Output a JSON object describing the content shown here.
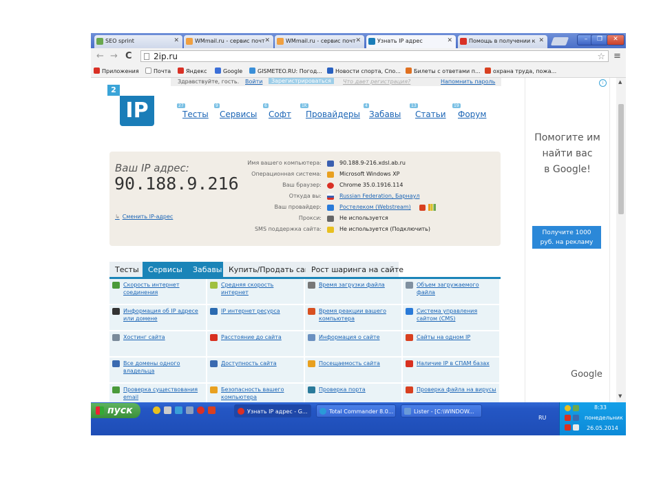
{
  "browser": {
    "tabs": [
      {
        "title": "SEO sprint",
        "color": "#6aa84f"
      },
      {
        "title": "WMmail.ru - сервис почт",
        "color": "#f0a040"
      },
      {
        "title": "WMmail.ru - сервис почт",
        "color": "#f0a040"
      },
      {
        "title": "Узнать IP адрес",
        "color": "#1a7db8"
      },
      {
        "title": "Помощь в получении к",
        "color": "#d93025"
      }
    ],
    "url": "2ip.ru",
    "bookmarks": [
      {
        "label": "Приложения",
        "color": "#d93025"
      },
      {
        "label": "Почта",
        "color": "#999999"
      },
      {
        "label": "Яндекс",
        "color": "#d93025"
      },
      {
        "label": "Google",
        "color": "#3b6fd8"
      },
      {
        "label": "GISMETEO.RU: Погод...",
        "color": "#3a8fd8"
      },
      {
        "label": "Новости спорта, Спо...",
        "color": "#2860c0"
      },
      {
        "label": "Билеты с ответами п...",
        "color": "#e07020"
      },
      {
        "label": "охрана труда, пожа...",
        "color": "#d84020"
      }
    ]
  },
  "site": {
    "topbar": {
      "greeting": "Здравствуйте, гость.",
      "login": "Войти",
      "register": "Зарегистрироваться",
      "why": "Что дает регистрация?",
      "forgot": "Напомнить пароль"
    },
    "logo_num": "2",
    "logo_text": "IP",
    "nav": [
      {
        "label": "Тесты",
        "badge": "27"
      },
      {
        "label": "Сервисы",
        "badge": "9"
      },
      {
        "label": "Софт",
        "badge": "6"
      },
      {
        "label": "Провайдеры",
        "badge": "1K"
      },
      {
        "label": "Забавы",
        "badge": "4"
      },
      {
        "label": "Статьи",
        "badge": "13"
      },
      {
        "label": "Форум",
        "badge": "19"
      }
    ],
    "ip": {
      "label": "Ваш IP адрес:",
      "address": "90.188.9.216",
      "change_link": "Сменить IP-адрес"
    },
    "info": [
      {
        "key": "Имя вашего компьютера:",
        "value": "90.188.9-216.xdsl.ab.ru",
        "link": false,
        "icon_color": "#3a5fb0"
      },
      {
        "key": "Операционная система:",
        "value": "Microsoft Windows XP",
        "link": false,
        "icon_color": "#e8a020"
      },
      {
        "key": "Ваш браузер:",
        "value": "Chrome 35.0.1916.114",
        "link": false,
        "icon_color": "#d93025"
      },
      {
        "key": "Откуда вы:",
        "value": "Russian Federation, Барнаул",
        "link": true,
        "icon_color": "#3a5fb0"
      },
      {
        "key": "Ваш провайдер:",
        "value": "Ростелеком (Webstream)",
        "link": true,
        "icon_color": "#2a7ad8"
      },
      {
        "key": "Прокси:",
        "value": "Не используется",
        "link": false,
        "icon_color": "#666666"
      },
      {
        "key": "SMS поддержка сайта:",
        "value": "Не используется (Подключить)",
        "link": false,
        "icon_color": "#e8c020"
      }
    ],
    "section_tabs": [
      "Тесты",
      "Сервисы",
      "Забавы",
      "Купить/Продать сайт",
      "Рост шаринга на сайте"
    ],
    "services": [
      {
        "label": "Скорость интернет соединения",
        "icon_color": "#4a9a3a"
      },
      {
        "label": "Средняя скорость интернет",
        "icon_color": "#a0c040"
      },
      {
        "label": "Время загрузки файла",
        "icon_color": "#777777"
      },
      {
        "label": "Объем загружаемого файла",
        "icon_color": "#8090a0"
      },
      {
        "label": "Информация об IP адресе или домене",
        "icon_color": "#333333"
      },
      {
        "label": "IP интернет ресурса",
        "icon_color": "#2a6ab0"
      },
      {
        "label": "Время реакции вашего компьютера",
        "icon_color": "#d85020"
      },
      {
        "label": "Система управления сайтом (CMS)",
        "icon_color": "#2a7ad8"
      },
      {
        "label": "Хостинг сайта",
        "icon_color": "#7a8a9a"
      },
      {
        "label": "Расстояние до сайта",
        "icon_color": "#d83020"
      },
      {
        "label": "Информация о сайте",
        "icon_color": "#6a90c0"
      },
      {
        "label": "Сайты на одном IP",
        "icon_color": "#d84020"
      },
      {
        "label": "Все домены одного владельца",
        "icon_color": "#3a6ab0"
      },
      {
        "label": "Доступность сайта",
        "icon_color": "#3a6ab0"
      },
      {
        "label": "Посещаемость сайта",
        "icon_color": "#e8a020"
      },
      {
        "label": "Наличие IP в СПАМ базах",
        "icon_color": "#d83020"
      },
      {
        "label": "Проверка существования email",
        "icon_color": "#4a9a3a"
      },
      {
        "label": "Безопасность вашего компьютера",
        "icon_color": "#e8a020"
      },
      {
        "label": "Проверка порта",
        "icon_color": "#2a7a9a"
      },
      {
        "label": "Проверка файла на вирусы",
        "icon_color": "#d84020"
      }
    ],
    "ad": {
      "line1": "Помогите им",
      "line2": "найти вас",
      "line3": "в Google!",
      "button_line1": "Получите 1000",
      "button_line2": "руб. на рекламу",
      "brand": "Google"
    }
  },
  "taskbar": {
    "start": "пуск",
    "tasks": [
      {
        "label": "Узнать IP адрес - G...",
        "icon_color": "#d93025"
      },
      {
        "label": "Total Commander 8.0...",
        "icon_color": "#2a9ad8"
      },
      {
        "label": "Lister - [C:\\WINDOW...",
        "icon_color": "#6a9ad8"
      }
    ],
    "lang": "RU",
    "time": "8:33",
    "day": "понедельник",
    "date": "26.05.2014"
  }
}
